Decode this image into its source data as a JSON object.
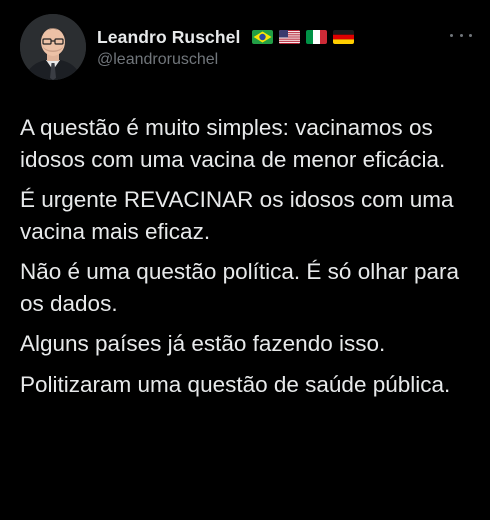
{
  "author": {
    "display_name": "Leandro Ruschel",
    "handle": "@leandroruschel",
    "flags": [
      "brazil-flag",
      "usa-flag",
      "italy-flag",
      "germany-flag"
    ]
  },
  "tweet": {
    "paragraphs": [
      "A questão é muito simples: vacinamos os idosos com uma vacina de menor eficácia.",
      "É urgente REVACINAR os idosos com uma vacina mais eficaz.",
      "Não é uma questão política. É só olhar para os dados.",
      "Alguns países já estão fazendo isso.",
      "Politizaram uma questão de saúde pública."
    ]
  },
  "colors": {
    "background": "#000000",
    "text": "#e7e9ea",
    "secondary": "#71767b"
  }
}
